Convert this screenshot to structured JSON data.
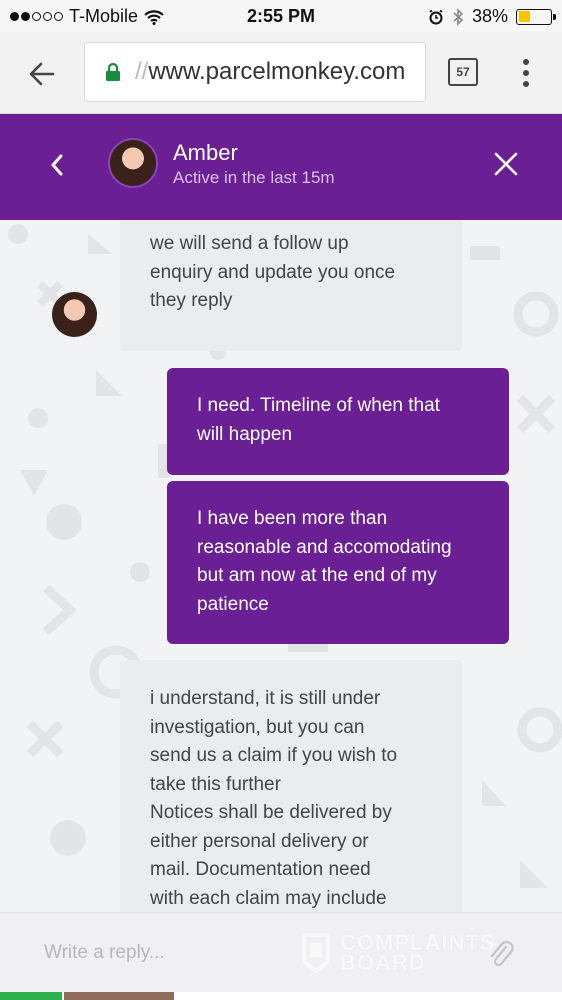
{
  "status_bar": {
    "carrier": "T-Mobile",
    "time": "2:55 PM",
    "battery": "38%",
    "battery_level": 0.38,
    "signal_bars": 2
  },
  "browser": {
    "url_faded": "//",
    "url": "www.parcelmonkey.com",
    "tab_count": "57",
    "icons": [
      "back-arrow-icon",
      "lock-icon",
      "tabs-icon",
      "more-vert-icon"
    ]
  },
  "chat_header": {
    "agent_name": "Amber",
    "agent_status": "Active in the last 15m",
    "accent": "#6a1f95"
  },
  "messages": [
    {
      "sender": "agent",
      "text": "we will send a follow up\nenquiry and update you once\nthey reply"
    },
    {
      "sender": "user",
      "text": "I need. Timeline of when that\nwill happen"
    },
    {
      "sender": "user",
      "text": "I have been more than\nreasonable and accomodating\nbut am now at the end of my\npatience"
    },
    {
      "sender": "agent",
      "text": "i understand, it is still under\ninvestigation, but you can\nsend us a claim if you wish to\ntake this further\nNotices shall be delivered by\neither personal delivery or\nmail. Documentation need\nwith each claim may include"
    }
  ],
  "reply": {
    "placeholder": "Write a reply..."
  },
  "watermark": {
    "line1": "COMPLAINTS",
    "line2": "BOARD"
  }
}
